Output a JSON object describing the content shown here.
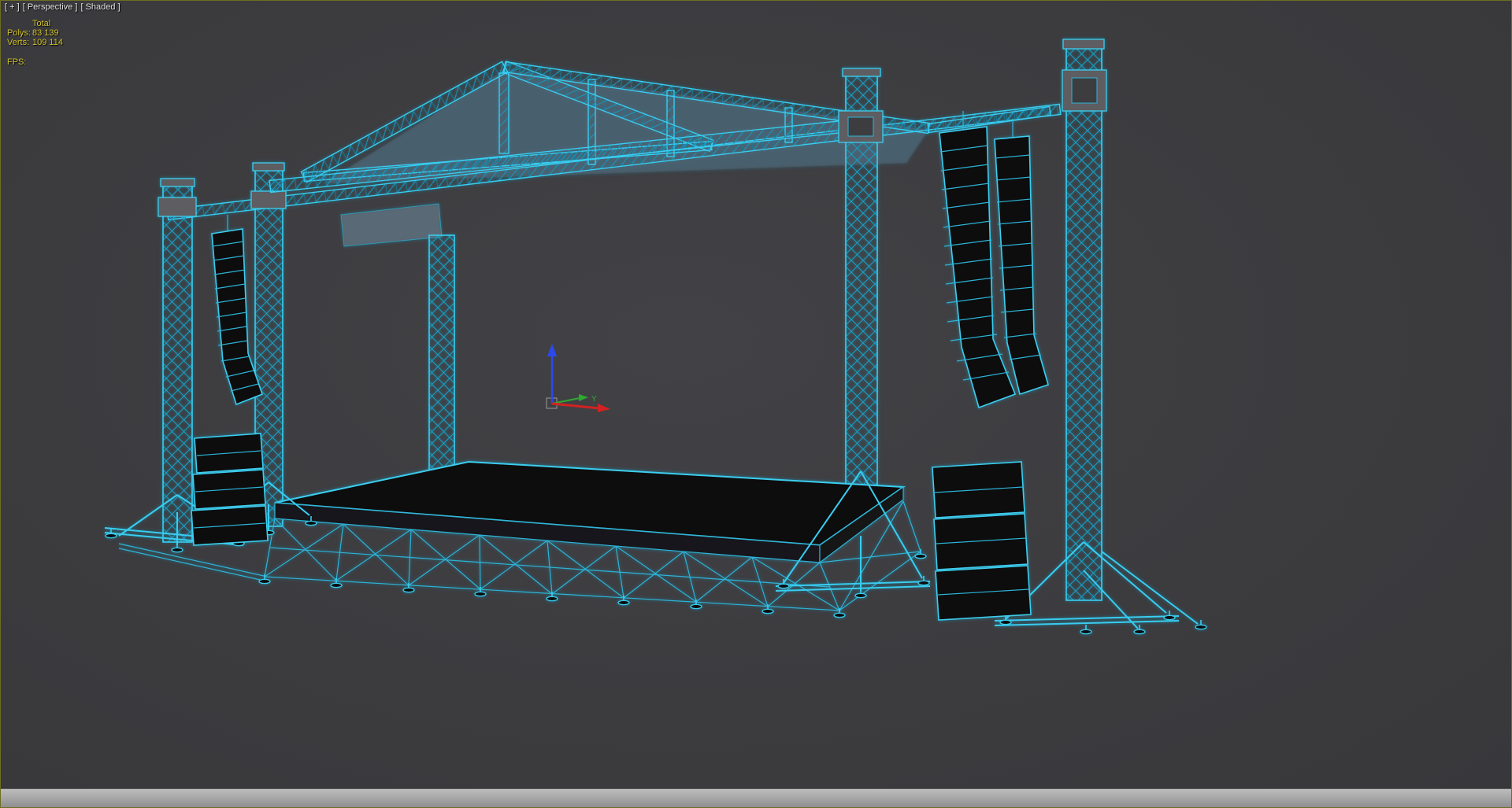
{
  "viewport": {
    "label": {
      "general": "[ + ]",
      "pov": "[ Perspective ]",
      "shading": "[ Shaded ]"
    },
    "statistics": {
      "header": "Total",
      "rows": [
        {
          "label": "Polys:",
          "value": "83 139"
        },
        {
          "label": "Verts:",
          "value": "109 114"
        }
      ],
      "fps_label": "FPS:",
      "fps_value": ""
    },
    "axis_gizmo": {
      "y_axis_label": "Y"
    },
    "colors": {
      "background": "#3c3c3f",
      "wireframe_cyan": "#38cdf0",
      "statistics_yellow": "#d2c228",
      "label_text": "#e0e0e0",
      "axis_x": "#d22222",
      "axis_y": "#2fa82f",
      "axis_z": "#2b49ee",
      "viewport_border": "#6e6e23",
      "bottom_bar": "#b0b0b0"
    }
  }
}
